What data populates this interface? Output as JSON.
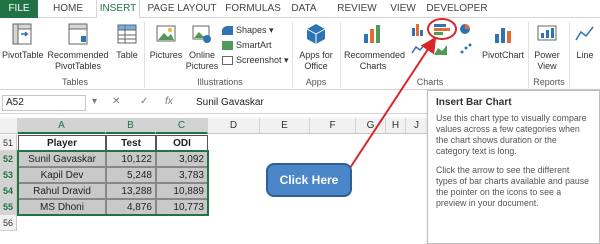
{
  "tabs": [
    "FILE",
    "HOME",
    "INSERT",
    "PAGE LAYOUT",
    "FORMULAS",
    "DATA",
    "REVIEW",
    "VIEW",
    "DEVELOPER"
  ],
  "ribbon": {
    "pivottable": "PivotTable",
    "recommended_pivottables": "Recommended PivotTables",
    "table": "Table",
    "tables_group": "Tables",
    "pictures": "Pictures",
    "online_pictures": "Online Pictures",
    "shapes": "Shapes",
    "smartart": "SmartArt",
    "screenshot": "Screenshot",
    "illustrations_group": "Illustrations",
    "apps_for_office": "Apps for Office",
    "apps_group": "Apps",
    "recommended_charts": "Recommended Charts",
    "pivotchart": "PivotChart",
    "charts_group": "Charts",
    "power_view": "Power View",
    "reports_group": "Reports",
    "line": "Line"
  },
  "formula_bar": {
    "name_box": "A52",
    "fx": "fx",
    "content": "Sunil Gavaskar"
  },
  "grid": {
    "columns": [
      "A",
      "B",
      "C",
      "D",
      "E",
      "F",
      "G",
      "H",
      "I",
      "J"
    ],
    "rows": [
      "51",
      "52",
      "53",
      "54",
      "55",
      "56"
    ],
    "headers": [
      "Player",
      "Test",
      "ODI"
    ],
    "data": [
      [
        "Sunil Gavaskar",
        "10,122",
        "3,092"
      ],
      [
        "Kapil Dev",
        "5,248",
        "3,783"
      ],
      [
        "Rahul Dravid",
        "13,288",
        "10,889"
      ],
      [
        "MS Dhoni",
        "4,876",
        "10,773"
      ]
    ]
  },
  "tooltip": {
    "title": "Insert Bar Chart",
    "body1": "Use this chart type to visually compare values across a few categories when the chart shows duration or the category text is long.",
    "body2": "Click the arrow to see the different types of bar charts available and pause the pointer on the icons to see a preview in your document."
  },
  "callout": "Click Here",
  "colors": {
    "excel_green": "#217346",
    "callout_blue": "#4a86c8",
    "arrow_red": "#d9262b"
  }
}
